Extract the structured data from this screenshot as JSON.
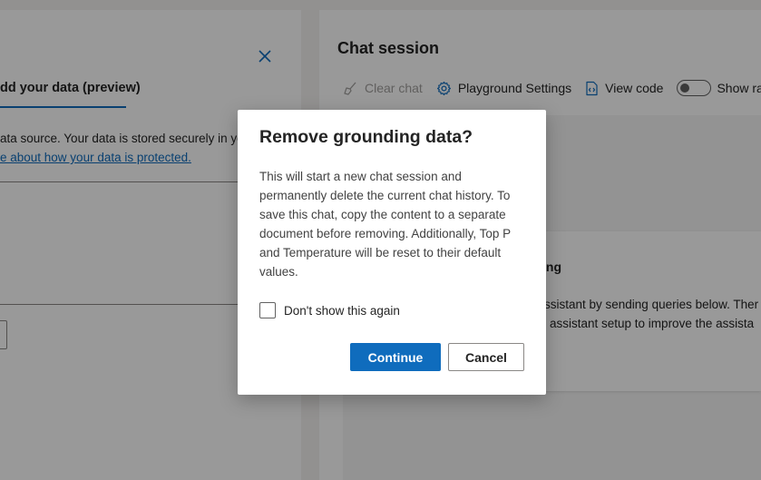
{
  "left_panel": {
    "tab_label": "dd your data (preview)",
    "description": "ata source. Your data is stored securely in yo",
    "link_text": "e about how your data is protected."
  },
  "chat_session": {
    "title": "Chat session",
    "toolbar": {
      "clear_chat": "Clear chat",
      "playground_settings": "Playground Settings",
      "view_code": "View code",
      "show_raw": "Show ra"
    },
    "card": {
      "heading_fragment": "ing",
      "line1": "ssistant by sending queries below. Ther",
      "line2": "assistant setup to improve the assista"
    }
  },
  "dialog": {
    "title": "Remove grounding data?",
    "body": "This will start a new chat session and permanently delete the current chat history. To save this chat, copy the content to a separate document before removing. Additionally, Top P and Temperature will be reset to their default values.",
    "checkbox_label": "Don't show this again",
    "checkbox_checked": false,
    "continue_label": "Continue",
    "cancel_label": "Cancel"
  },
  "colors": {
    "accent": "#0f6cbd",
    "overlay": "rgba(0,0,0,0.4)"
  }
}
